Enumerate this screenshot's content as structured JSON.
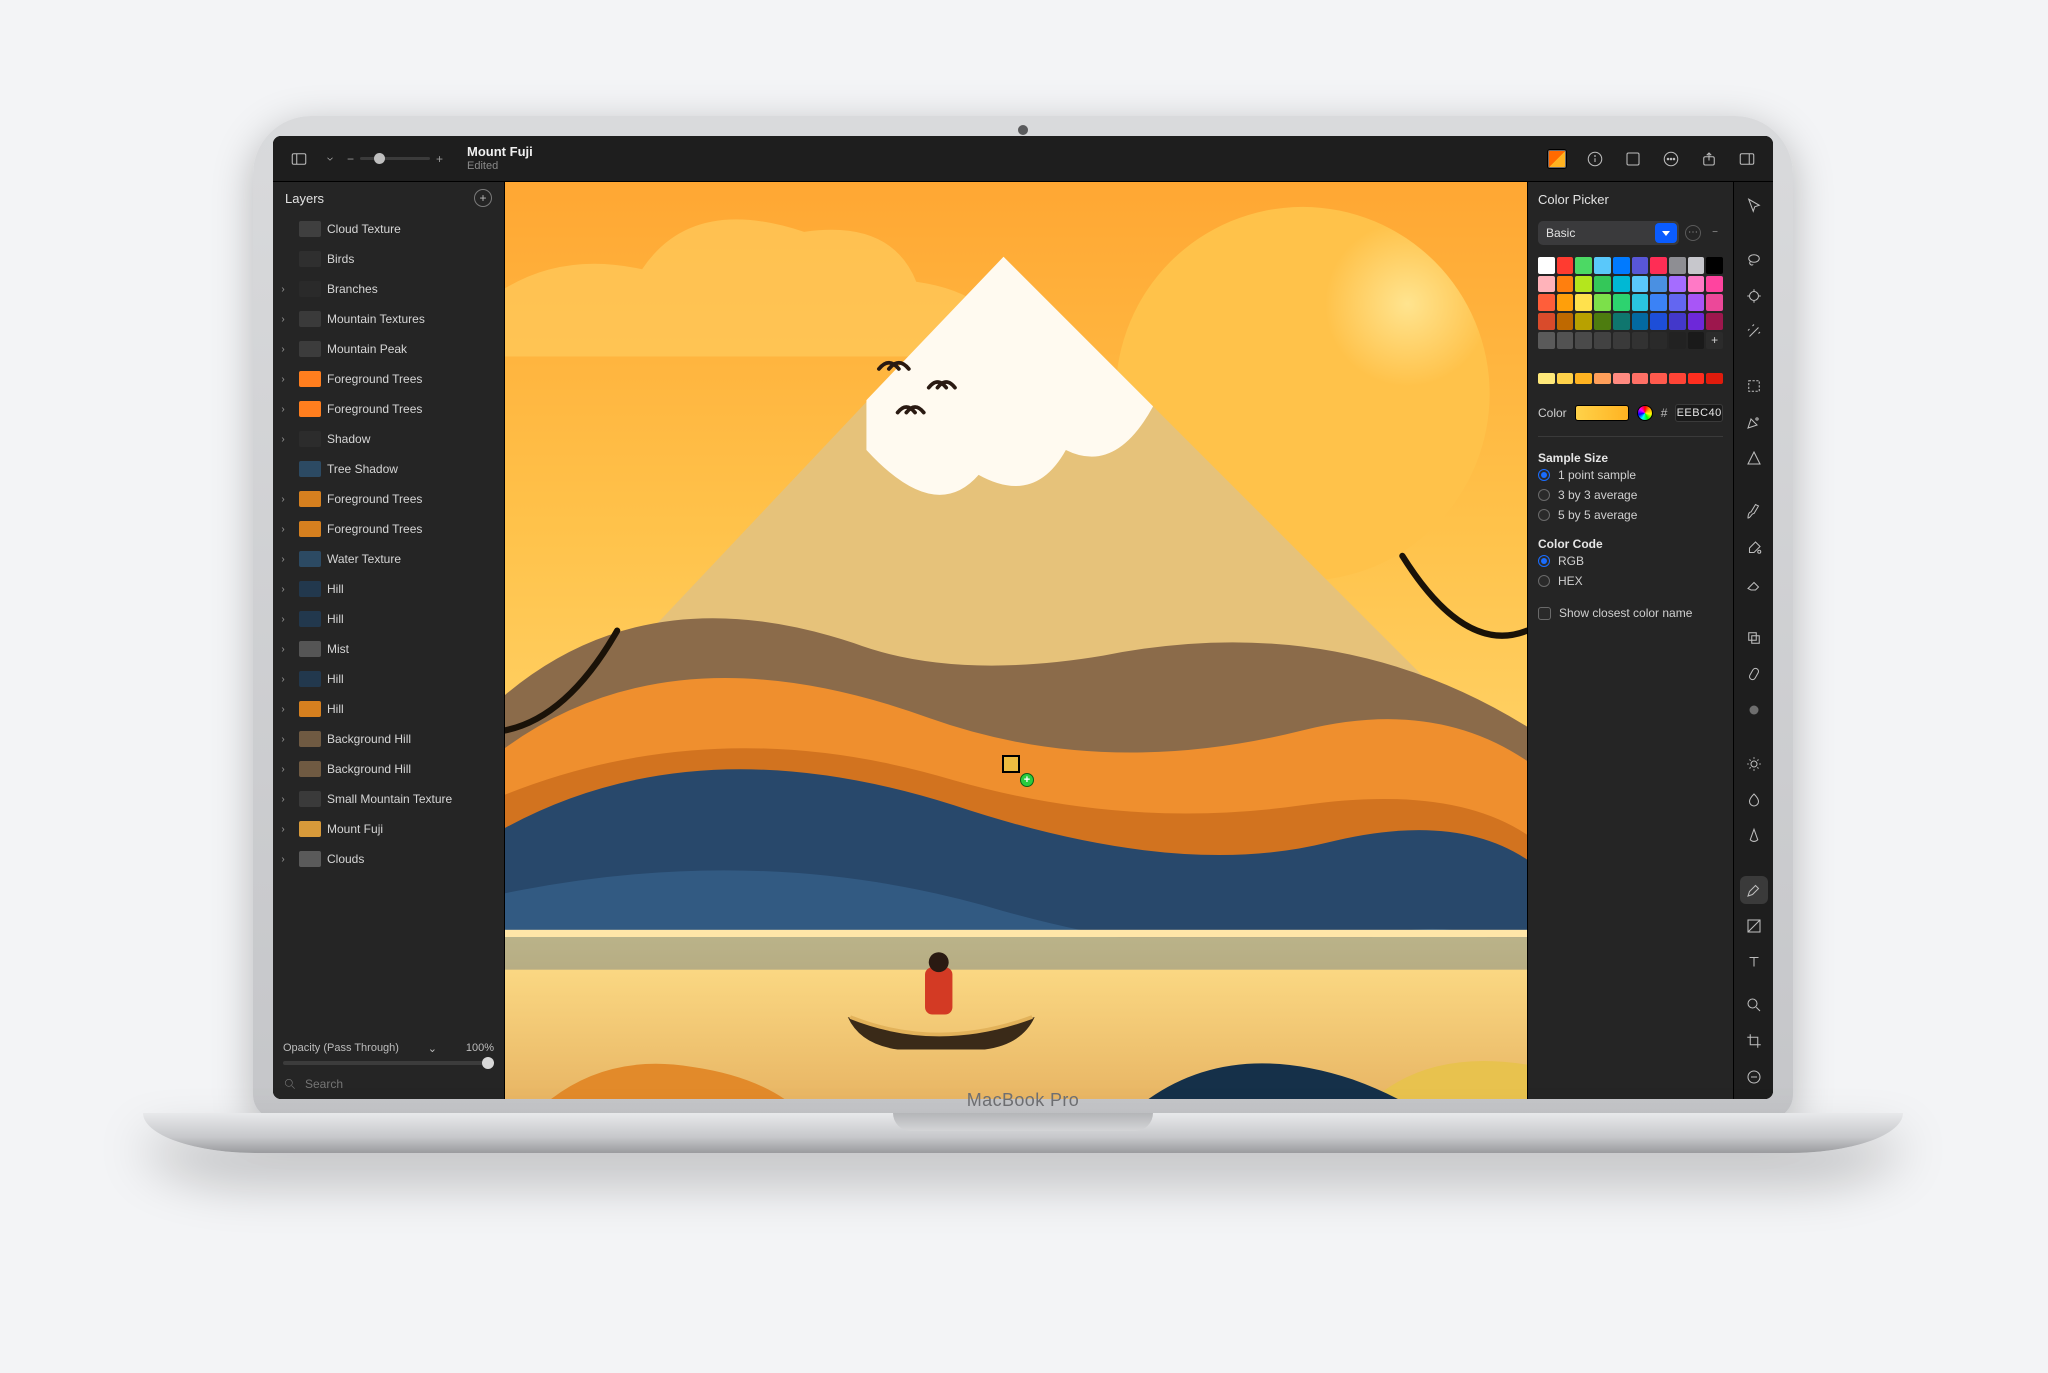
{
  "device": {
    "label": "MacBook Pro"
  },
  "toolbar": {
    "title": "Mount Fuji",
    "subtitle": "Edited"
  },
  "layers": {
    "panel_title": "Layers",
    "items": [
      {
        "name": "Cloud Texture",
        "disclosure": false,
        "thumb": "#3f3f3f"
      },
      {
        "name": "Birds",
        "disclosure": false,
        "thumb": "#2f2f2f"
      },
      {
        "name": "Branches",
        "disclosure": true,
        "thumb": "#2a2a2a"
      },
      {
        "name": "Mountain Textures",
        "disclosure": true,
        "thumb": "#3a3a3a"
      },
      {
        "name": "Mountain Peak",
        "disclosure": true,
        "thumb": "#3c3c3c"
      },
      {
        "name": "Foreground Trees",
        "disclosure": true,
        "thumb": "#ff7e1e"
      },
      {
        "name": "Foreground Trees",
        "disclosure": true,
        "thumb": "#ff7e1e"
      },
      {
        "name": "Shadow",
        "disclosure": true,
        "thumb": "#2c2c2c"
      },
      {
        "name": "Tree Shadow",
        "disclosure": false,
        "thumb": "#2c4a63"
      },
      {
        "name": "Foreground Trees",
        "disclosure": true,
        "thumb": "#d6801f"
      },
      {
        "name": "Foreground Trees",
        "disclosure": true,
        "thumb": "#d6801f"
      },
      {
        "name": "Water Texture",
        "disclosure": true,
        "thumb": "#2c4a63"
      },
      {
        "name": "Hill",
        "disclosure": true,
        "thumb": "#22384d"
      },
      {
        "name": "Hill",
        "disclosure": true,
        "thumb": "#22384d"
      },
      {
        "name": "Mist",
        "disclosure": true,
        "thumb": "#555555"
      },
      {
        "name": "Hill",
        "disclosure": true,
        "thumb": "#22384d"
      },
      {
        "name": "Hill",
        "disclosure": true,
        "thumb": "#d6801f"
      },
      {
        "name": "Background Hill",
        "disclosure": true,
        "thumb": "#6f5a42"
      },
      {
        "name": "Background Hill",
        "disclosure": true,
        "thumb": "#6f5a42"
      },
      {
        "name": "Small Mountain Texture",
        "disclosure": true,
        "thumb": "#3a3a3a"
      },
      {
        "name": "Mount Fuji",
        "disclosure": true,
        "thumb": "#d89a3a"
      },
      {
        "name": "Clouds",
        "disclosure": true,
        "thumb": "#5a5a5a"
      }
    ],
    "opacity_label": "Opacity (Pass Through)",
    "opacity_value": "100%",
    "search_placeholder": "Search"
  },
  "inspector": {
    "title": "Color Picker",
    "palette_select": "Basic",
    "palette": [
      "#ffffff",
      "#ff3b30",
      "#4cd964",
      "#5ac8fa",
      "#007aff",
      "#5856d6",
      "#ff2d55",
      "#8e8e93",
      "#c7c7cc",
      "#000000",
      "#ffb3ba",
      "#ff7f0e",
      "#b4e61d",
      "#34c759",
      "#00b8d4",
      "#5ac8fa",
      "#4a90e2",
      "#a56cff",
      "#ff79c6",
      "#ff449f",
      "#ff5e3a",
      "#ff9f0a",
      "#ffe14d",
      "#7ce04a",
      "#2dd36f",
      "#2ac3de",
      "#3b82f6",
      "#6366f1",
      "#a855f7",
      "#ec4899",
      "#d94b2b",
      "#bf6900",
      "#b8a100",
      "#4d7c0f",
      "#0f766e",
      "#0369a1",
      "#1d4ed8",
      "#4338ca",
      "#6d28d9",
      "#9d174d",
      "#5a5a5a",
      "#525252",
      "#4a4a4a",
      "#424242",
      "#3a3a3a",
      "#323232",
      "#2a2a2a",
      "#222222",
      "#1a1a1a"
    ],
    "hue_row": [
      "#ffe97a",
      "#ffd24a",
      "#ffb321",
      "#ff9f5a",
      "#ff8a80",
      "#ff7066",
      "#ff5a4d",
      "#ff4436",
      "#ff2e1f",
      "#e01b0c"
    ],
    "color_label": "Color",
    "hex_value": "EEBC40",
    "sample_size_title": "Sample Size",
    "sample_options": [
      {
        "label": "1 point sample",
        "checked": true
      },
      {
        "label": "3 by 3 average",
        "checked": false
      },
      {
        "label": "5 by 5 average",
        "checked": false
      }
    ],
    "color_code_title": "Color Code",
    "code_options": [
      {
        "label": "RGB",
        "checked": true
      },
      {
        "label": "HEX",
        "checked": false
      }
    ],
    "closest_name_label": "Show closest color name",
    "closest_name_checked": false
  }
}
